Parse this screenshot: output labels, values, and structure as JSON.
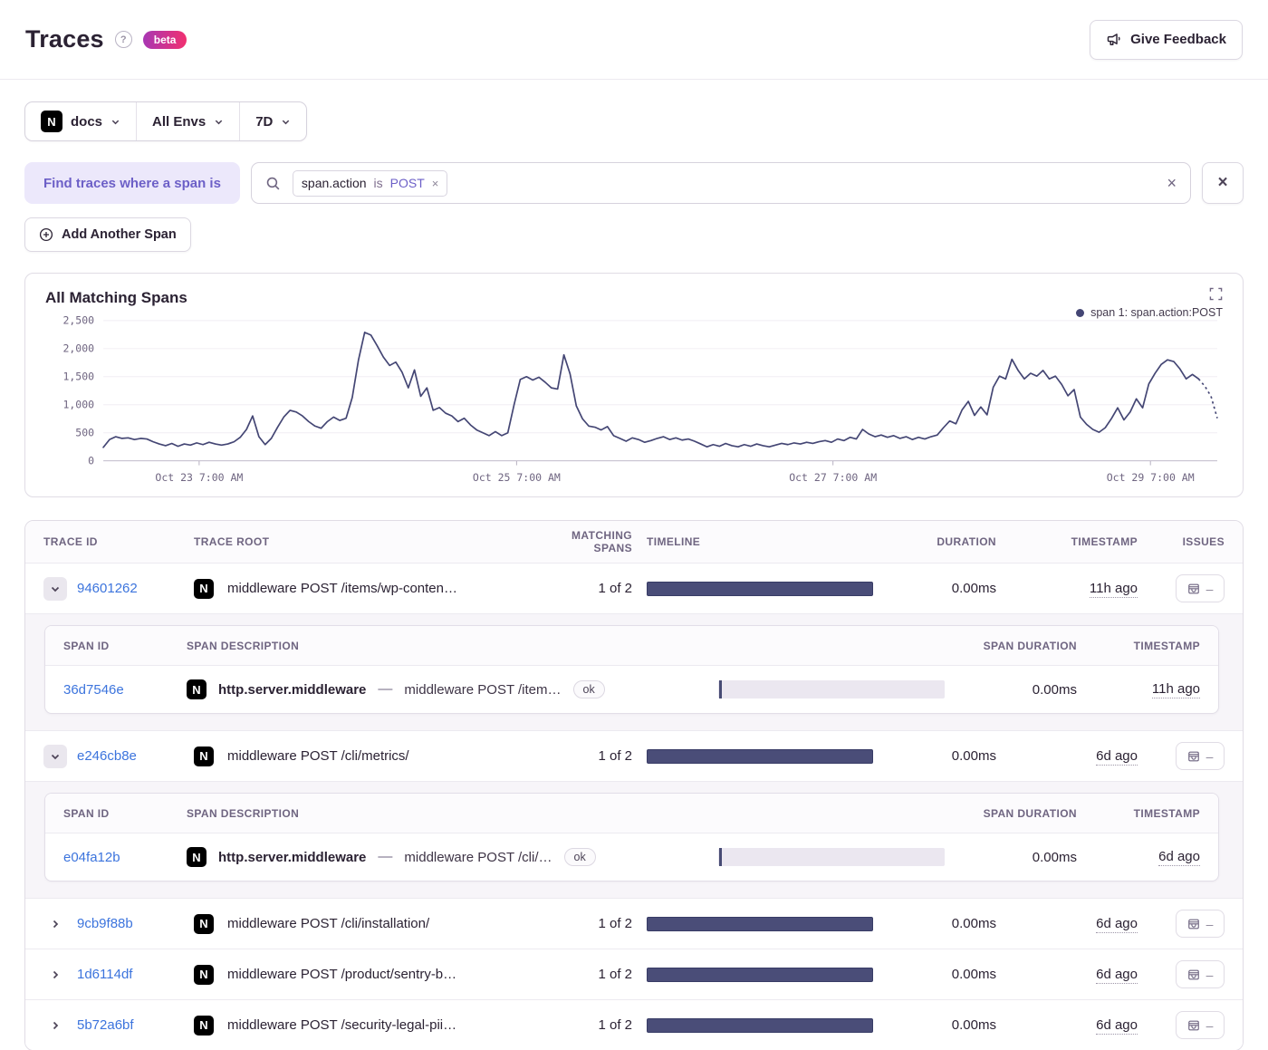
{
  "header": {
    "title": "Traces",
    "help_icon": "?",
    "beta_label": "beta",
    "feedback_label": "Give Feedback"
  },
  "filters": {
    "project": "docs",
    "project_icon_letter": "N",
    "env": "All Envs",
    "period": "7D"
  },
  "span_filter": {
    "label": "Find traces where a span is",
    "token_key": "span.action",
    "token_op": "is",
    "token_value": "POST",
    "token_remove_icon": "×",
    "clear_icon": "×",
    "close_icon": "×",
    "add_span_label": "Add Another Span"
  },
  "chart": {
    "title": "All Matching Spans",
    "legend": "span 1: span.action:POST"
  },
  "chart_data": {
    "type": "line",
    "title": "All Matching Spans",
    "legend": [
      "span 1: span.action:POST"
    ],
    "legend_position": "top-right",
    "line_color": "#444674",
    "grid": true,
    "ylim": [
      0,
      2500
    ],
    "yticks": [
      {
        "value": 0,
        "label": "0"
      },
      {
        "value": 500,
        "label": "500"
      },
      {
        "value": 1000,
        "label": "1,000"
      },
      {
        "value": 1500,
        "label": "1,500"
      },
      {
        "value": 2000,
        "label": "2,000"
      },
      {
        "value": 2500,
        "label": "2,500"
      }
    ],
    "xticks": [
      {
        "f": 0.086,
        "label": "Oct 23 7:00 AM"
      },
      {
        "f": 0.371,
        "label": "Oct 25 7:00 AM"
      },
      {
        "f": 0.655,
        "label": "Oct 27 7:00 AM"
      },
      {
        "f": 0.94,
        "label": "Oct 29 7:00 AM"
      }
    ],
    "xlabel": "",
    "ylabel": "",
    "dashed_tail_points": 3,
    "values": [
      240,
      380,
      430,
      400,
      410,
      380,
      400,
      390,
      340,
      300,
      270,
      310,
      260,
      300,
      280,
      320,
      290,
      330,
      300,
      280,
      300,
      340,
      420,
      560,
      800,
      430,
      290,
      400,
      600,
      780,
      900,
      870,
      800,
      700,
      620,
      580,
      700,
      780,
      720,
      760,
      1130,
      1800,
      2290,
      2240,
      2050,
      1850,
      1700,
      1760,
      1580,
      1300,
      1620,
      1150,
      1300,
      900,
      950,
      850,
      800,
      700,
      760,
      640,
      550,
      500,
      450,
      520,
      450,
      500,
      1000,
      1450,
      1500,
      1440,
      1490,
      1400,
      1300,
      1280,
      1890,
      1550,
      980,
      750,
      620,
      600,
      550,
      610,
      450,
      400,
      350,
      410,
      380,
      330,
      360,
      400,
      430,
      380,
      410,
      370,
      390,
      350,
      300,
      250,
      290,
      260,
      310,
      270,
      250,
      290,
      260,
      300,
      270,
      250,
      280,
      310,
      290,
      320,
      300,
      330,
      310,
      340,
      360,
      330,
      390,
      360,
      420,
      390,
      560,
      480,
      430,
      460,
      420,
      450,
      400,
      430,
      380,
      420,
      390,
      430,
      460,
      590,
      710,
      660,
      910,
      1060,
      810,
      960,
      820,
      1310,
      1510,
      1460,
      1810,
      1610,
      1460,
      1560,
      1510,
      1610,
      1460,
      1510,
      1360,
      1160,
      1270,
      780,
      650,
      560,
      510,
      590,
      755,
      945,
      730,
      870,
      1105,
      945,
      1370,
      1560,
      1720,
      1800,
      1770,
      1640,
      1460,
      1540,
      1460,
      1330,
      1150,
      760
    ]
  },
  "table": {
    "columns": {
      "trace_id": "Trace ID",
      "trace_root": "Trace Root",
      "matching_spans": "Matching Spans",
      "timeline": "Timeline",
      "duration": "Duration",
      "timestamp": "Timestamp",
      "issues": "Issues"
    },
    "span_columns": {
      "span_id": "Span ID",
      "span_description": "Span Description",
      "span_duration": "Span Duration",
      "timestamp": "Timestamp"
    },
    "issues_empty": "–",
    "project_icon_letter": "N",
    "rows": [
      {
        "id": "94601262",
        "root": "middleware POST /items/wp-conten…",
        "matching": "1 of 2",
        "duration": "0.00ms",
        "timestamp": "11h ago",
        "expanded": true,
        "spans": [
          {
            "id": "36d7546e",
            "op": "http.server.middleware",
            "dash": "—",
            "desc": "middleware POST /item…",
            "status": "ok",
            "duration": "0.00ms",
            "timestamp": "11h ago"
          }
        ]
      },
      {
        "id": "e246cb8e",
        "root": "middleware POST /cli/metrics/",
        "matching": "1 of 2",
        "duration": "0.00ms",
        "timestamp": "6d ago",
        "expanded": true,
        "spans": [
          {
            "id": "e04fa12b",
            "op": "http.server.middleware",
            "dash": "—",
            "desc": "middleware POST /cli/…",
            "status": "ok",
            "duration": "0.00ms",
            "timestamp": "6d ago"
          }
        ]
      },
      {
        "id": "9cb9f88b",
        "root": "middleware POST /cli/installation/",
        "matching": "1 of 2",
        "duration": "0.00ms",
        "timestamp": "6d ago",
        "expanded": false,
        "spans": []
      },
      {
        "id": "1d6114df",
        "root": "middleware POST /product/sentry-b…",
        "matching": "1 of 2",
        "duration": "0.00ms",
        "timestamp": "6d ago",
        "expanded": false,
        "spans": []
      },
      {
        "id": "5b72a6bf",
        "root": "middleware POST /security-legal-pii…",
        "matching": "1 of 2",
        "duration": "0.00ms",
        "timestamp": "6d ago",
        "expanded": false,
        "spans": []
      }
    ]
  }
}
